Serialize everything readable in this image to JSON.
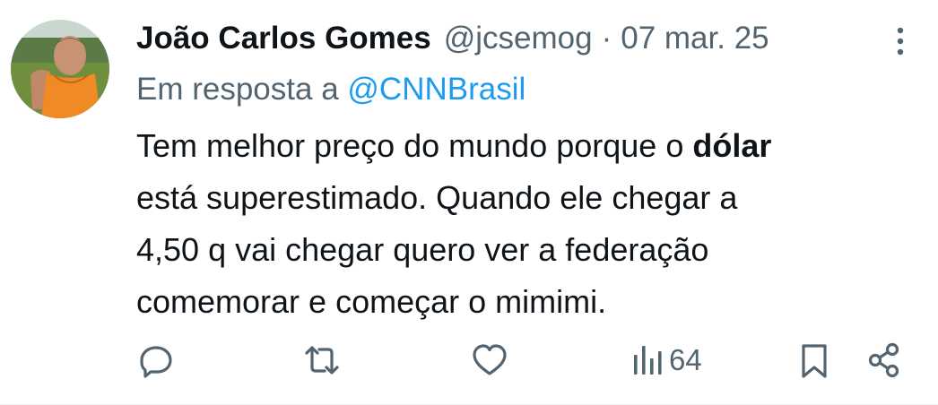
{
  "tweet": {
    "author_name": "João Carlos Gomes",
    "handle": "@jcsemog",
    "separator": "·",
    "date": "07 mar. 25",
    "reply_prefix": "Em resposta a",
    "reply_to": "@CNNBrasil",
    "text": {
      "line1_pre": "Tem melhor preço do mundo porque o",
      "line1_bold": "dólar",
      "line2": "está superestimado. Quando ele chegar a",
      "line3": "4,50 q vai chegar quero ver a federação",
      "line4": "comemorar e começar o mimimi."
    }
  },
  "actions": {
    "reply_icon": "reply-icon",
    "retweet_icon": "retweet-icon",
    "like_icon": "heart-icon",
    "views_icon": "views-chart-icon",
    "views_count": "64",
    "bookmark_icon": "bookmark-icon",
    "share_icon": "share-icon"
  },
  "colors": {
    "text_primary": "#0f1419",
    "text_secondary": "#536471",
    "link": "#1d9bf0",
    "avatar_shirt": "#f08a24"
  }
}
